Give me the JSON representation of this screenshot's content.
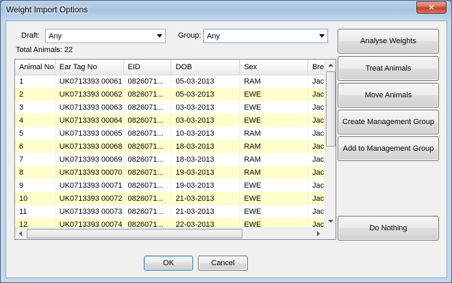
{
  "window": {
    "title": "Weight Import Options",
    "close_glyph": "✕"
  },
  "filters": {
    "draft_label": "Draft:",
    "draft_value": "Any",
    "group_label": "Group:",
    "group_value": "Any",
    "total_animals": "Total Animals: 22"
  },
  "grid": {
    "columns": [
      "Animal No",
      "Ear Tag No",
      "EID",
      "DOB",
      "Sex",
      "Bre"
    ],
    "rows": [
      [
        "1",
        "UK0713393 00061",
        "0826071...",
        "05-03-2013",
        "RAM",
        "Jac"
      ],
      [
        "2",
        "UK0713393 00062",
        "0826071...",
        "05-03-2013",
        "EWE",
        "Jac"
      ],
      [
        "3",
        "UK0713393 00063",
        "0826071...",
        "03-03-2013",
        "EWE",
        "Jac"
      ],
      [
        "4",
        "UK0713393 00064",
        "0826071...",
        "03-03-2013",
        "EWE",
        "Jac"
      ],
      [
        "5",
        "UK0713393 00065",
        "0826071...",
        "10-03-2013",
        "RAM",
        "Jac"
      ],
      [
        "6",
        "UK0713393 00068",
        "0826071...",
        "18-03-2013",
        "RAM",
        "Jac"
      ],
      [
        "7",
        "UK0713393 00069",
        "0826071...",
        "18-03-2013",
        "RAM",
        "Jac"
      ],
      [
        "8",
        "UK0713393 00070",
        "0826071...",
        "19-03-2013",
        "RAM",
        "Jac"
      ],
      [
        "9",
        "UK0713393 00071",
        "0826071...",
        "19-03-2013",
        "EWE",
        "Jac"
      ],
      [
        "10",
        "UK0713393 00072",
        "0826071...",
        "21-03-2013",
        "EWE",
        "Jac"
      ],
      [
        "11",
        "UK0713393 00073",
        "0826071...",
        "21-03-2013",
        "EWE",
        "Jac"
      ],
      [
        "12",
        "UK0713393 00074",
        "0826071...",
        "22-03-2013",
        "EWE",
        "Jac"
      ]
    ],
    "alt_row_color": "#ffffcc"
  },
  "actions": {
    "analyse": "Analyse Weights",
    "treat": "Treat Animals",
    "move": "Move Animals",
    "create_group": "Create Management Group",
    "add_group": "Add to Management Group",
    "nothing": "Do Nothing"
  },
  "footer": {
    "ok": "OK",
    "cancel": "Cancel"
  },
  "icons": {
    "close": "close-icon",
    "dropdown": "chevron-down-icon",
    "scroll_up": "arrow-up-icon",
    "scroll_down": "arrow-down-icon",
    "scroll_left": "arrow-left-icon",
    "scroll_right": "arrow-right-icon"
  }
}
